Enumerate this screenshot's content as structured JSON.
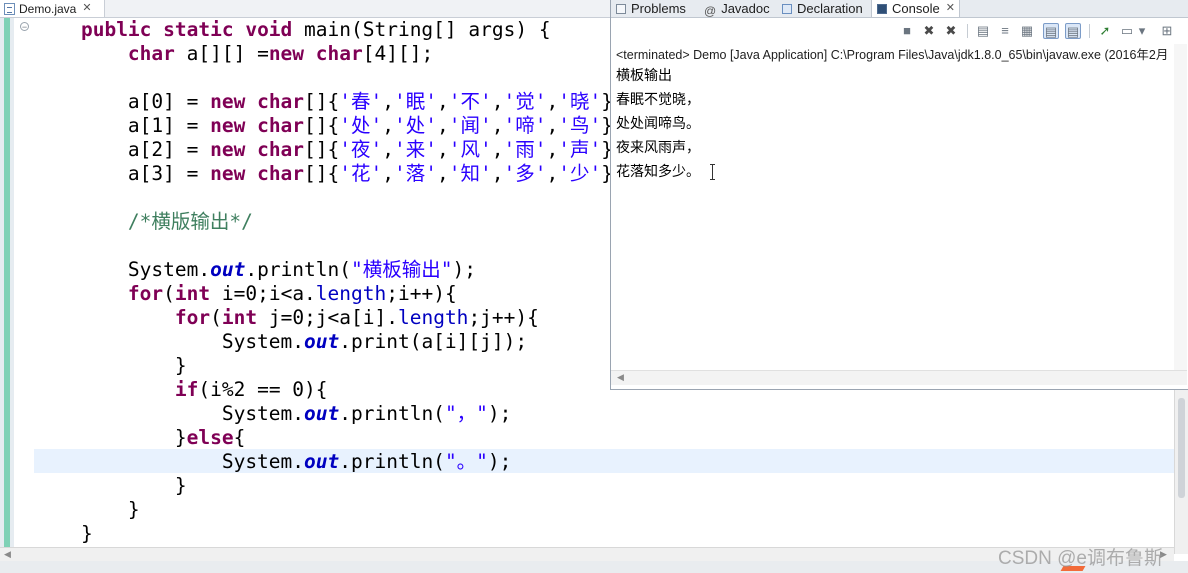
{
  "editor": {
    "tab": {
      "title": "Demo.java",
      "close": "✕"
    },
    "fold_icon": "−",
    "hscroll": {
      "left": "◀",
      "right": "▶"
    },
    "lines": [
      [
        [
          "    ",
          ""
        ],
        [
          "public static void ",
          "kw"
        ],
        [
          "main(String[] args) {",
          ""
        ]
      ],
      [
        [
          "        ",
          ""
        ],
        [
          "char ",
          "kw"
        ],
        [
          "a[][] =",
          ""
        ],
        [
          "new ",
          "kw"
        ],
        [
          "char",
          "kw"
        ],
        [
          "[4][];",
          ""
        ]
      ],
      [
        [
          "",
          ""
        ]
      ],
      [
        [
          "        a[0] = ",
          ""
        ],
        [
          "new ",
          "kw"
        ],
        [
          "char",
          "kw"
        ],
        [
          "[]{",
          ""
        ],
        [
          "'春'",
          "str"
        ],
        [
          ",",
          ""
        ],
        [
          "'眠'",
          "str"
        ],
        [
          ",",
          ""
        ],
        [
          "'不'",
          "str"
        ],
        [
          ",",
          ""
        ],
        [
          "'觉'",
          "str"
        ],
        [
          ",",
          ""
        ],
        [
          "'晓'",
          "str"
        ],
        [
          "}",
          ""
        ]
      ],
      [
        [
          "        a[1] = ",
          ""
        ],
        [
          "new ",
          "kw"
        ],
        [
          "char",
          "kw"
        ],
        [
          "[]{",
          ""
        ],
        [
          "'处'",
          "str"
        ],
        [
          ",",
          ""
        ],
        [
          "'处'",
          "str"
        ],
        [
          ",",
          ""
        ],
        [
          "'闻'",
          "str"
        ],
        [
          ",",
          ""
        ],
        [
          "'啼'",
          "str"
        ],
        [
          ",",
          ""
        ],
        [
          "'鸟'",
          "str"
        ],
        [
          "}",
          ""
        ]
      ],
      [
        [
          "        a[2] = ",
          ""
        ],
        [
          "new ",
          "kw"
        ],
        [
          "char",
          "kw"
        ],
        [
          "[]{",
          ""
        ],
        [
          "'夜'",
          "str"
        ],
        [
          ",",
          ""
        ],
        [
          "'来'",
          "str"
        ],
        [
          ",",
          ""
        ],
        [
          "'风'",
          "str"
        ],
        [
          ",",
          ""
        ],
        [
          "'雨'",
          "str"
        ],
        [
          ",",
          ""
        ],
        [
          "'声'",
          "str"
        ],
        [
          "}",
          ""
        ]
      ],
      [
        [
          "        a[3] = ",
          ""
        ],
        [
          "new ",
          "kw"
        ],
        [
          "char",
          "kw"
        ],
        [
          "[]{",
          ""
        ],
        [
          "'花'",
          "str"
        ],
        [
          ",",
          ""
        ],
        [
          "'落'",
          "str"
        ],
        [
          ",",
          ""
        ],
        [
          "'知'",
          "str"
        ],
        [
          ",",
          ""
        ],
        [
          "'多'",
          "str"
        ],
        [
          ",",
          ""
        ],
        [
          "'少'",
          "str"
        ],
        [
          "}",
          ""
        ]
      ],
      [
        [
          "",
          ""
        ]
      ],
      [
        [
          "        ",
          ""
        ],
        [
          "/*横版输出*/",
          "cmt"
        ]
      ],
      [
        [
          "",
          ""
        ]
      ],
      [
        [
          "        System.",
          ""
        ],
        [
          "out",
          "sfld"
        ],
        [
          ".println(",
          ""
        ],
        [
          "\"横板输出\"",
          "str"
        ],
        [
          ");",
          ""
        ]
      ],
      [
        [
          "        ",
          ""
        ],
        [
          "for",
          "kw"
        ],
        [
          "(",
          ""
        ],
        [
          "int ",
          "kw"
        ],
        [
          "i=0;i<a.",
          ""
        ],
        [
          "length",
          "fld"
        ],
        [
          ";i++){",
          ""
        ]
      ],
      [
        [
          "            ",
          ""
        ],
        [
          "for",
          "kw"
        ],
        [
          "(",
          ""
        ],
        [
          "int ",
          "kw"
        ],
        [
          "j=0;j<a[i].",
          ""
        ],
        [
          "length",
          "fld"
        ],
        [
          ";j++){",
          ""
        ]
      ],
      [
        [
          "                System.",
          ""
        ],
        [
          "out",
          "sfld"
        ],
        [
          ".print(a[i][j]);",
          ""
        ]
      ],
      [
        [
          "            }",
          ""
        ]
      ],
      [
        [
          "            ",
          ""
        ],
        [
          "if",
          "kw"
        ],
        [
          "(i%2 == 0){",
          ""
        ]
      ],
      [
        [
          "                System.",
          ""
        ],
        [
          "out",
          "sfld"
        ],
        [
          ".println(",
          ""
        ],
        [
          "\"，\"",
          "str"
        ],
        [
          ");",
          ""
        ]
      ],
      [
        [
          "            }",
          ""
        ],
        [
          "else",
          "kw"
        ],
        [
          "{",
          ""
        ]
      ],
      [
        [
          "                System.",
          ""
        ],
        [
          "out",
          "sfld"
        ],
        [
          ".println(",
          ""
        ],
        [
          "\"。\"",
          "str"
        ],
        [
          ");",
          ""
        ]
      ],
      [
        [
          "            }",
          ""
        ]
      ],
      [
        [
          "        }",
          ""
        ]
      ],
      [
        [
          "    }",
          ""
        ]
      ]
    ]
  },
  "console_view": {
    "tabs": [
      {
        "label": "Problems",
        "icon": "problems-icon"
      },
      {
        "label": "Javadoc",
        "icon": "javadoc-icon",
        "glyph": "@"
      },
      {
        "label": "Declaration",
        "icon": "declaration-icon"
      },
      {
        "label": "Console",
        "icon": "console-icon",
        "close": "✕"
      }
    ],
    "toolbar": {
      "terminate": "■",
      "remove_launch": "✖",
      "remove_all": "✖",
      "clear": "▤",
      "scroll_lock": "≡",
      "word_wrap": "▦",
      "show_on_output": "▤",
      "show_on_error": "▤",
      "pin": "➚",
      "display_selected": "▭",
      "dropdown": "▾",
      "open_console": "⊞"
    },
    "header": "<terminated> Demo [Java Application] C:\\Program Files\\Java\\jdk1.8.0_65\\bin\\javaw.exe (2016年2月",
    "output": [
      "横板输出",
      "春眠不觉晓，",
      "处处闻啼鸟。",
      "夜来风雨声，",
      "花落知多少。"
    ],
    "scroll_left": "◀"
  },
  "watermark": "CSDN @e调布鲁斯",
  "colors": {
    "keyword": "#7f0055",
    "string": "#2a00ff",
    "comment": "#3f7f5f",
    "field": "#0000c0",
    "current_line": "#e8f2fe"
  }
}
